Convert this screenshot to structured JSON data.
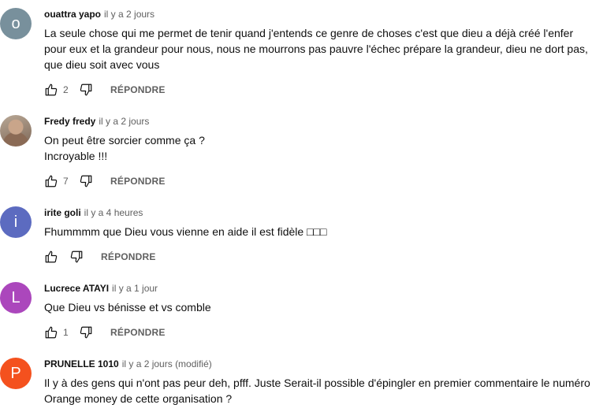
{
  "comments": [
    {
      "avatar_letter": "o",
      "avatar_color": "#78909c",
      "author": "ouattra yapo",
      "time": "il y a 2 jours",
      "lines": [
        "La seule chose qui me permet de tenir quand j'entends ce genre de choses c'est que dieu a déjà créé l'enfer",
        "pour eux et la grandeur pour nous, nous ne mourrons pas pauvre l'échec prépare la grandeur, dieu ne dort pas,",
        "que dieu soit avec vous"
      ],
      "likes": "2",
      "reply_label": "RÉPONDRE"
    },
    {
      "avatar_letter": "",
      "avatar_color": "#b19a86",
      "author": "Fredy fredy",
      "time": "il y a 2 jours",
      "lines": [
        "On peut être sorcier comme ça ?",
        "Incroyable !!!"
      ],
      "likes": "7",
      "reply_label": "RÉPONDRE"
    },
    {
      "avatar_letter": "i",
      "avatar_color": "#5c6bc0",
      "author": "irite goli",
      "time": "il y a 4 heures",
      "lines": [
        "Fhummmm que Dieu vous vienne en aide il est fidèle □□□"
      ],
      "likes": "",
      "reply_label": "RÉPONDRE"
    },
    {
      "avatar_letter": "L",
      "avatar_color": "#ab47bc",
      "author": "Lucrece ATAYI",
      "time": "il y a 1 jour",
      "lines": [
        "Que Dieu vs bénisse et vs comble"
      ],
      "likes": "1",
      "reply_label": "RÉPONDRE"
    },
    {
      "avatar_letter": "P",
      "avatar_color": "#f4511e",
      "author": "PRUNELLE 1010",
      "time": "il y a 2 jours (modifié)",
      "lines": [
        "Il y à des gens qui n'ont pas peur deh, pfff. Juste Serait-il possible d'épingler en premier commentaire le numéro",
        "Orange money de cette organisation ?"
      ],
      "likes": "",
      "reply_label": ""
    }
  ]
}
